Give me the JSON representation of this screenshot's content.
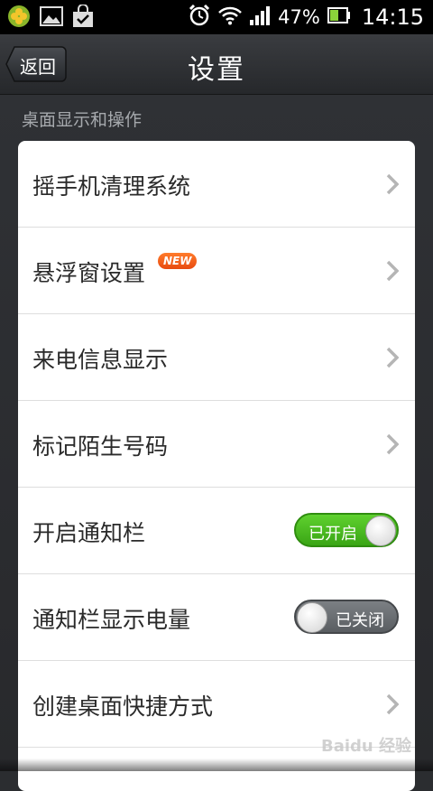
{
  "status_bar": {
    "battery_percent": "47%",
    "time": "14:15",
    "icons": [
      "app-clover-icon",
      "image-icon",
      "shopping-bag-icon",
      "alarm-icon",
      "wifi-icon",
      "signal-icon",
      "battery-icon"
    ]
  },
  "header": {
    "back_label": "返回",
    "title": "设置"
  },
  "section": {
    "title": "桌面显示和操作"
  },
  "items": [
    {
      "label": "摇手机清理系统",
      "type": "chevron"
    },
    {
      "label": "悬浮窗设置",
      "type": "chevron",
      "badge": "NEW"
    },
    {
      "label": "来电信息显示",
      "type": "chevron"
    },
    {
      "label": "标记陌生号码",
      "type": "chevron"
    },
    {
      "label": "开启通知栏",
      "type": "toggle",
      "state": "on",
      "state_label": "已开启"
    },
    {
      "label": "通知栏显示电量",
      "type": "toggle",
      "state": "off",
      "state_label": "已关闭"
    },
    {
      "label": "创建桌面快捷方式",
      "type": "chevron"
    }
  ],
  "watermark": "Baidu 经验",
  "colors": {
    "toggle_on": "#4cc022",
    "toggle_off": "#6a6e72",
    "badge": "#f05a14"
  }
}
